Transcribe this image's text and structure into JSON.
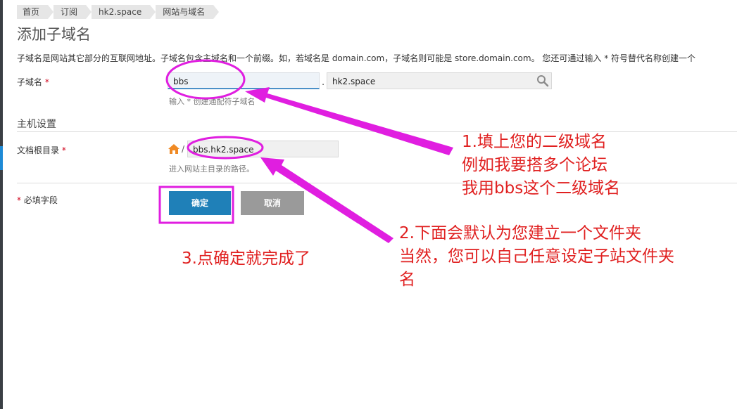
{
  "breadcrumb": [
    "首页",
    "订阅",
    "hk2.space",
    "网站与域名"
  ],
  "page_title": "添加子域名",
  "intro": "子域名是网站其它部分的互联网地址。子域名包含主域名和一个前缀。如，若域名是 domain.com，子域名则可能是 store.domain.com。 您还可通过输入 * 符号替代名称创建一个",
  "subdomain": {
    "label": "子域名",
    "required_mark": "*",
    "value": "bbs",
    "separator": ".",
    "domain_value": "hk2.space",
    "hint": "输入 * 创建通配符子域名"
  },
  "host_settings": {
    "title": "主机设置",
    "doc_root_label": "文档根目录",
    "required_mark": "*",
    "path_separator": "/",
    "doc_root_value": "bbs.hk2.space",
    "hint": "进入网站主目录的路径。"
  },
  "required_note": {
    "mark": "*",
    "text": "必填字段"
  },
  "buttons": {
    "ok": "确定",
    "cancel": "取消"
  },
  "annotations": {
    "note1": [
      "1.填上您的二级域名",
      "例如我要搭多个论坛",
      "我用bbs这个二级域名"
    ],
    "note2": [
      "2.下面会默认为您建立一个文件夹",
      "当然，您可以自己任意设定子站文件夹",
      "名"
    ],
    "note3": "3.点确定就完成了"
  },
  "colors": {
    "annotation_text": "#e02020",
    "annotation_marker": "#e01ee0",
    "ok_button": "#1f80b8",
    "cancel_button": "#9a9a9a"
  },
  "icons": [
    "search-icon",
    "home-icon"
  ]
}
